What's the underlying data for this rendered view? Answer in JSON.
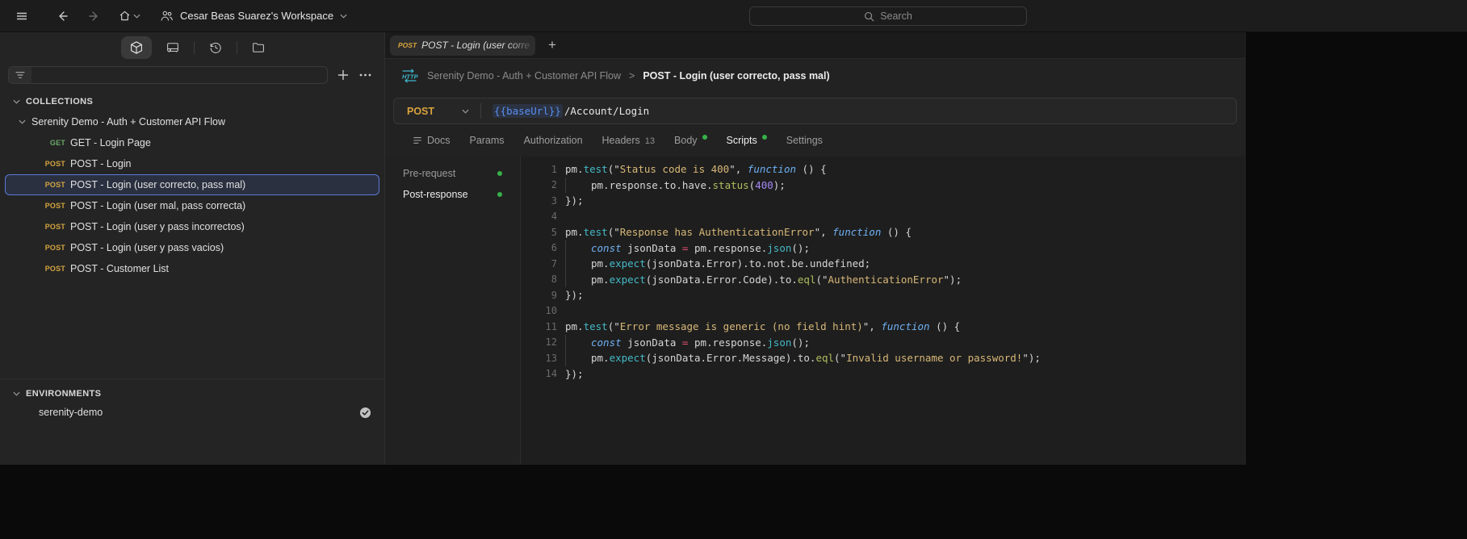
{
  "topbar": {
    "workspace": "Cesar Beas Suarez's Workspace",
    "search_placeholder": "Search"
  },
  "sidebar": {
    "collections_header": "COLLECTIONS",
    "collection": {
      "name": "Serenity Demo - Auth + Customer API Flow"
    },
    "requests": [
      {
        "method": "GET",
        "label": "GET - Login Page",
        "selected": false
      },
      {
        "method": "POST",
        "label": "POST - Login",
        "selected": false
      },
      {
        "method": "POST",
        "label": "POST - Login (user correcto, pass mal)",
        "selected": true
      },
      {
        "method": "POST",
        "label": "POST - Login (user mal, pass correcta)",
        "selected": false
      },
      {
        "method": "POST",
        "label": "POST - Login (user y pass incorrectos)",
        "selected": false
      },
      {
        "method": "POST",
        "label": "POST - Login (user y pass vacios)",
        "selected": false
      },
      {
        "method": "POST",
        "label": "POST - Customer List",
        "selected": false
      }
    ],
    "environments_header": "ENVIRONMENTS",
    "environment": {
      "name": "serenity-demo",
      "active": true
    }
  },
  "tabbar": {
    "tab": {
      "method": "POST",
      "title": "POST - Login (user corre"
    },
    "new_tab_label": "+"
  },
  "breadcrumb": {
    "collection": "Serenity Demo - Auth + Customer API Flow",
    "separator": ">",
    "current": "POST - Login (user correcto, pass mal)"
  },
  "request": {
    "method": "POST",
    "url_variable": "{{baseUrl}}",
    "url_path": "/Account/Login"
  },
  "request_tabs": [
    {
      "label": "Docs",
      "icon": "docs"
    },
    {
      "label": "Params"
    },
    {
      "label": "Authorization"
    },
    {
      "label": "Headers",
      "badge": "13"
    },
    {
      "label": "Body",
      "dot": true
    },
    {
      "label": "Scripts",
      "dot": true,
      "active": true
    },
    {
      "label": "Settings"
    }
  ],
  "scripts_panel": {
    "subtabs": [
      {
        "label": "Pre-request",
        "dot": true,
        "active": false
      },
      {
        "label": "Post-response",
        "dot": true,
        "active": true
      }
    ]
  },
  "colors": {
    "method_get": "#6aa968",
    "method_post": "#d3a43f",
    "selected_border": "#5b79d8",
    "dot_green": "#35b24a",
    "variable_blue": "#588ef2",
    "http_badge": "#3fb7cd"
  },
  "editor": {
    "lines": [
      {
        "n": "1",
        "ind": 0,
        "tokens": [
          [
            "p",
            "pm."
          ],
          [
            "f",
            "test"
          ],
          [
            "p",
            "(\""
          ],
          [
            "s",
            "Status code is 400"
          ],
          [
            "p",
            "\", "
          ],
          [
            "k",
            "function"
          ],
          [
            "p",
            " () {"
          ]
        ]
      },
      {
        "n": "2",
        "ind": 1,
        "tokens": [
          [
            "p",
            "pm.response.to.have."
          ],
          [
            "m",
            "status"
          ],
          [
            "p",
            "("
          ],
          [
            "n",
            "400"
          ],
          [
            "p",
            ");"
          ]
        ]
      },
      {
        "n": "3",
        "ind": 0,
        "tokens": [
          [
            "p",
            "});"
          ]
        ]
      },
      {
        "n": "4",
        "ind": 0,
        "tokens": []
      },
      {
        "n": "5",
        "ind": 0,
        "tokens": [
          [
            "p",
            "pm."
          ],
          [
            "f",
            "test"
          ],
          [
            "p",
            "(\""
          ],
          [
            "s",
            "Response has AuthenticationError"
          ],
          [
            "p",
            "\", "
          ],
          [
            "k",
            "function"
          ],
          [
            "p",
            " () {"
          ]
        ]
      },
      {
        "n": "6",
        "ind": 1,
        "tokens": [
          [
            "k",
            "const"
          ],
          [
            "p",
            " jsonData "
          ],
          [
            "o",
            "="
          ],
          [
            "p",
            " pm.response."
          ],
          [
            "f",
            "json"
          ],
          [
            "p",
            "();"
          ]
        ]
      },
      {
        "n": "7",
        "ind": 1,
        "tokens": [
          [
            "p",
            "pm."
          ],
          [
            "f",
            "expect"
          ],
          [
            "p",
            "(jsonData.Error).to.not.be.undefined;"
          ]
        ]
      },
      {
        "n": "8",
        "ind": 1,
        "tokens": [
          [
            "p",
            "pm."
          ],
          [
            "f",
            "expect"
          ],
          [
            "p",
            "(jsonData.Error.Code).to."
          ],
          [
            "m",
            "eql"
          ],
          [
            "p",
            "(\""
          ],
          [
            "s",
            "AuthenticationError"
          ],
          [
            "p",
            "\");"
          ]
        ]
      },
      {
        "n": "9",
        "ind": 0,
        "tokens": [
          [
            "p",
            "});"
          ]
        ]
      },
      {
        "n": "10",
        "ind": 0,
        "tokens": []
      },
      {
        "n": "11",
        "ind": 0,
        "tokens": [
          [
            "p",
            "pm."
          ],
          [
            "f",
            "test"
          ],
          [
            "p",
            "(\""
          ],
          [
            "s",
            "Error message is generic (no field hint)"
          ],
          [
            "p",
            "\", "
          ],
          [
            "k",
            "function"
          ],
          [
            "p",
            " () {"
          ]
        ]
      },
      {
        "n": "12",
        "ind": 1,
        "tokens": [
          [
            "k",
            "const"
          ],
          [
            "p",
            " jsonData "
          ],
          [
            "o",
            "="
          ],
          [
            "p",
            " pm.response."
          ],
          [
            "f",
            "json"
          ],
          [
            "p",
            "();"
          ]
        ]
      },
      {
        "n": "13",
        "ind": 1,
        "tokens": [
          [
            "p",
            "pm."
          ],
          [
            "f",
            "expect"
          ],
          [
            "p",
            "(jsonData.Error.Message).to."
          ],
          [
            "m",
            "eql"
          ],
          [
            "p",
            "(\""
          ],
          [
            "s",
            "Invalid username or password!"
          ],
          [
            "p",
            "\");"
          ]
        ]
      },
      {
        "n": "14",
        "ind": 0,
        "tokens": [
          [
            "p",
            "});"
          ]
        ]
      }
    ]
  }
}
